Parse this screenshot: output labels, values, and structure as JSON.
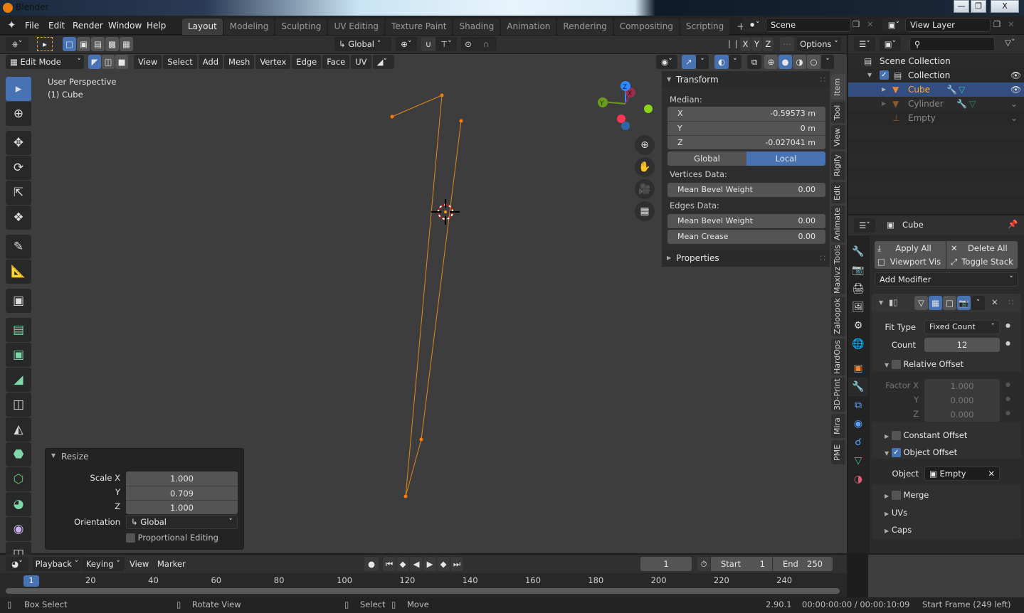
{
  "window": {
    "title": "Blender",
    "controls": [
      "minimize",
      "maximize",
      "close"
    ]
  },
  "menu": [
    "File",
    "Edit",
    "Render",
    "Window",
    "Help"
  ],
  "workspaces": {
    "tabs": [
      "Layout",
      "Modeling",
      "Sculpting",
      "UV Editing",
      "Texture Paint",
      "Shading",
      "Animation",
      "Rendering",
      "Compositing",
      "Scripting"
    ],
    "active": "Layout",
    "add_label": "+"
  },
  "scene": {
    "name": "Scene",
    "view_layer": "View Layer"
  },
  "tool_header": {
    "orientation": "Global",
    "axes": [
      "X",
      "Y",
      "Z"
    ],
    "options_label": "Options"
  },
  "viewport_header": {
    "mode": "Edit Mode",
    "menus": [
      "View",
      "Select",
      "Add",
      "Mesh",
      "Vertex",
      "Edge",
      "Face",
      "UV"
    ]
  },
  "viewport": {
    "perspective_label": "User Perspective",
    "object_label": "(1) Cube",
    "gizmo_axes": [
      "X",
      "Y",
      "Z"
    ]
  },
  "npanel": {
    "transform_title": "Transform",
    "median_label": "Median:",
    "median": [
      {
        "axis": "X",
        "value": "-0.59573 m"
      },
      {
        "axis": "Y",
        "value": "0 m"
      },
      {
        "axis": "Z",
        "value": "-0.027041 m"
      }
    ],
    "space_toggle": [
      "Global",
      "Local"
    ],
    "space_active": "Local",
    "vertices_data_label": "Vertices Data:",
    "vertices_mean_bevel": {
      "label": "Mean Bevel Weight",
      "value": "0.00"
    },
    "edges_data_label": "Edges Data:",
    "edges_mean_bevel": {
      "label": "Mean Bevel Weight",
      "value": "0.00"
    },
    "edges_mean_crease": {
      "label": "Mean Crease",
      "value": "0.00"
    },
    "properties_title": "Properties",
    "tabs": [
      "Item",
      "Tool",
      "View",
      "Rigify",
      "Edit",
      "Animate",
      "Maxivz Tools",
      "Zaloopok",
      "HardOps",
      "3D-Print",
      "Mira",
      "PME"
    ],
    "active_tab": "Item"
  },
  "resize_panel": {
    "title": "Resize",
    "scale_x_label": "Scale X",
    "scale_x": "1.000",
    "y_label": "Y",
    "scale_y": "0.709",
    "z_label": "Z",
    "scale_z": "1.000",
    "orientation_label": "Orientation",
    "orientation": "Global",
    "proportional_label": "Proportional Editing",
    "proportional": false
  },
  "outliner": {
    "root": "Scene Collection",
    "collection": "Collection",
    "items": [
      {
        "name": "Cube",
        "selected": true,
        "visible": true
      },
      {
        "name": "Cylinder",
        "selected": false,
        "visible": false
      },
      {
        "name": "Empty",
        "selected": false,
        "visible": false
      }
    ]
  },
  "properties": {
    "object_name": "Cube",
    "apply_all": "Apply All",
    "delete_all": "Delete All",
    "viewport_vis": "Viewport Vis",
    "toggle_stack": "Toggle Stack",
    "add_modifier": "Add Modifier",
    "fit_type_label": "Fit Type",
    "fit_type": "Fixed Count",
    "count_label": "Count",
    "count": "12",
    "relative_offset": {
      "label": "Relative Offset",
      "checked": false
    },
    "factor_x_label": "Factor X",
    "factor_x": "1.000",
    "factor_y_label": "Y",
    "factor_y": "0.000",
    "factor_z_label": "Z",
    "factor_z": "0.000",
    "constant_offset": {
      "label": "Constant Offset",
      "checked": false
    },
    "object_offset": {
      "label": "Object Offset",
      "checked": true
    },
    "object_label": "Object",
    "object_value": "Empty",
    "merge": {
      "label": "Merge",
      "checked": false
    },
    "uvs_label": "UVs",
    "caps_label": "Caps"
  },
  "timeline": {
    "menus": [
      "Playback",
      "Keying",
      "View",
      "Marker"
    ],
    "current_frame": "1",
    "start_label": "Start",
    "start": "1",
    "end_label": "End",
    "end": "250",
    "ticks": [
      "20",
      "40",
      "60",
      "80",
      "100",
      "120",
      "140",
      "160",
      "180",
      "200",
      "220",
      "240"
    ],
    "playhead": "1"
  },
  "status": {
    "box_select": "Box Select",
    "rotate_view": "Rotate View",
    "select": "Select",
    "move": "Move",
    "version": "2.90.1",
    "time": "00:00:00:00 / 00:00:10:09",
    "frame_info": "Start Frame (249 left)"
  }
}
